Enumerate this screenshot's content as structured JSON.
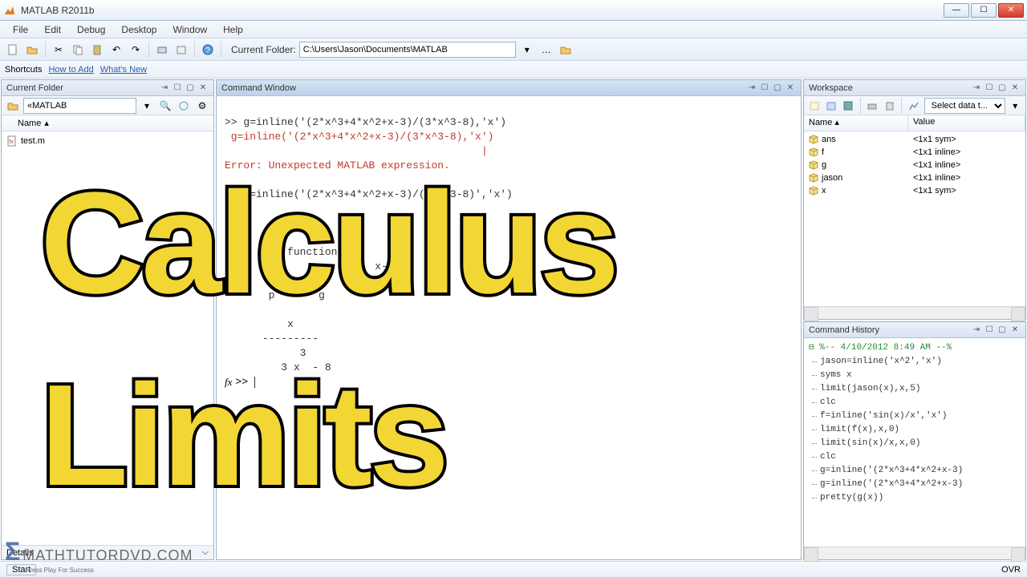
{
  "window": {
    "title": "MATLAB R2011b"
  },
  "menu": {
    "file": "File",
    "edit": "Edit",
    "debug": "Debug",
    "desktop": "Desktop",
    "window": "Window",
    "help": "Help"
  },
  "toolbar": {
    "folder_label": "Current Folder:",
    "folder_path": "C:\\Users\\Jason\\Documents\\MATLAB"
  },
  "shortcuts": {
    "label": "Shortcuts",
    "howto": "How to Add",
    "whatsnew": "What's New"
  },
  "current_folder": {
    "title": "Current Folder",
    "location": "MATLAB",
    "name_header": "Name",
    "files": [
      {
        "name": "test.m"
      }
    ],
    "details": "Details"
  },
  "command_window": {
    "title": "Command Window",
    "lines": {
      "l1": ">> g=inline('(2*x^3+4*x^2+x-3)/(3*x^3-8),'x')",
      "l2": " g=inline('(2*x^3+4*x^2+x-3)/(3*x^3-8),'x')",
      "l3_cursor": "|",
      "l4": "Error: Unexpected MATLAB expression.",
      "l5": ">> g=inline('(2*x^3+4*x^2+x-3)/(3*x^3-8)','x')",
      "l6": "g =",
      "l7": "        e function:",
      "l8": "       = (              x-3     x^3",
      "l9": "       p       g",
      "l10": "          x",
      "l11": "      ---------",
      "l12": "            3",
      "l13": "         3 x  - 8",
      "prompt": ">> "
    },
    "fx_label": "fx"
  },
  "workspace": {
    "title": "Workspace",
    "select_label": "Select data t...",
    "cols": {
      "name": "Name",
      "value": "Value"
    },
    "vars": [
      {
        "name": "ans",
        "value": "<1x1 sym>"
      },
      {
        "name": "f",
        "value": "<1x1 inline>"
      },
      {
        "name": "g",
        "value": "<1x1 inline>"
      },
      {
        "name": "jason",
        "value": "<1x1 inline>"
      },
      {
        "name": "x",
        "value": "<1x1 sym>"
      }
    ]
  },
  "command_history": {
    "title": "Command History",
    "date": "%-- 4/10/2012 8:49 AM --%",
    "entries": [
      "jason=inline('x^2','x')",
      "syms x",
      "limit(jason(x),x,5)",
      "clc",
      "f=inline('sin(x)/x','x')",
      "limit(f(x),x,0)",
      "limit(sin(x)/x,x,0)",
      "clc",
      "g=inline('(2*x^3+4*x^2+x-3)",
      "g=inline('(2*x^3+4*x^2+x-3)",
      "pretty(g(x))"
    ]
  },
  "statusbar": {
    "ovr": "OVR"
  },
  "overlay": {
    "calculus": "Calculus",
    "limits": "Limits"
  },
  "watermark": {
    "text": "MATHTUTORDVD.COM",
    "subtitle": "Press Play For Success"
  },
  "start_btn": "Start"
}
